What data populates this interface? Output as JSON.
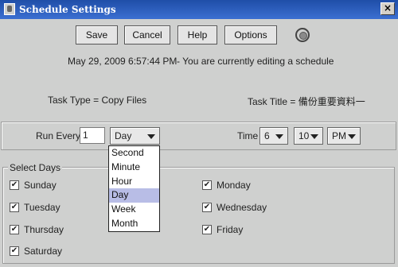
{
  "window": {
    "title": "Schedule Settings",
    "close_glyph": "×"
  },
  "toolbar": {
    "save_label": "Save",
    "cancel_label": "Cancel",
    "help_label": "Help",
    "options_label": "Options",
    "extra_icon": "settings-icon"
  },
  "status": {
    "timestamp": "May 29, 2009 6:57:44 PM",
    "editing_text": "-  You are currently editing a schedule"
  },
  "task": {
    "type_text": "Task Type = Copy Files",
    "title_text": "Task Title = 備份重要資料一"
  },
  "run": {
    "run_every_label": "Run Every",
    "interval_value": "1",
    "unit_value": "Day",
    "time_label": "Time",
    "hour_value": "6",
    "minute_value": "10",
    "ampm_value": "PM"
  },
  "unit_dropdown": {
    "options": [
      "Second",
      "Minute",
      "Hour",
      "Day",
      "Week",
      "Month"
    ],
    "selected": "Day",
    "highlight_color": "#b8bde6"
  },
  "days": {
    "legend": "Select Days",
    "check_glyph": "✔",
    "items": [
      {
        "label": "Sunday",
        "checked": true
      },
      {
        "label": "Monday",
        "checked": true
      },
      {
        "label": "Tuesday",
        "checked": true
      },
      {
        "label": "Wednesday",
        "checked": true
      },
      {
        "label": "Thursday",
        "checked": true
      },
      {
        "label": "Friday",
        "checked": true
      },
      {
        "label": "Saturday",
        "checked": true
      }
    ]
  }
}
